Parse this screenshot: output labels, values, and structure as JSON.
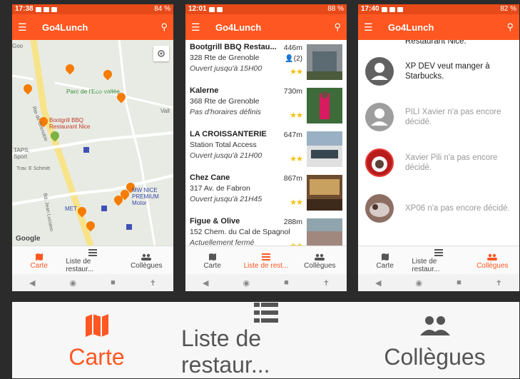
{
  "screens": [
    {
      "status_time": "17:38",
      "battery": "84 %",
      "app_title": "Go4Lunch",
      "map_labels": {
        "park": "Parc de l'Eco-vallée",
        "bbq": "Bootgrill BBQ Restaurant Nice",
        "taps": "TAPS, Sport",
        "mw": "MW NICE PREMIUM Motor",
        "met": "MET",
        "trav": "Trav. E Schmitt",
        "rte": "Rte de Grenoble",
        "jean": "Bd. Jean Luciano",
        "goo": "Goo",
        "vall": "Vall",
        "google": "Google"
      }
    },
    {
      "status_time": "12:01",
      "battery": "88 %",
      "app_title": "Go4Lunch",
      "restaurants": [
        {
          "name": "Bootgrill BBQ Restau...",
          "address": "328 Rte de Grenoble",
          "hours": "Ouvert jusqu'à 15H00",
          "distance": "446m",
          "workmates": "(2)",
          "stars": "★★"
        },
        {
          "name": "Kalerne",
          "address": "368 Rte de Grenoble",
          "hours": "Pas d'horaires définis",
          "distance": "730m",
          "stars": "★★"
        },
        {
          "name": "LA CROISSANTERIE",
          "address": "Station Total Access",
          "hours": "Ouvert jusqu'à 21H00",
          "distance": "647m",
          "stars": "★★"
        },
        {
          "name": "Chez Cane",
          "address": "317 Av. de Fabron",
          "hours": "Ouvert jusqu'à 21H45",
          "distance": "867m",
          "stars": "★★"
        },
        {
          "name": "Figue & Olive",
          "address": "152 Chem. du Cal de Spagnol",
          "hours": "Actuellement fermé",
          "distance": "288m",
          "stars": "★★"
        }
      ]
    },
    {
      "status_time": "17:40",
      "battery": "82 %",
      "app_title": "Go4Lunch",
      "top_partial": "Restaurant Nice.",
      "colleagues": [
        {
          "text": "XP DEV veut manger à Starbucks.",
          "decided": true
        },
        {
          "text": "PILI Xavier n'a pas encore décidé.",
          "decided": false
        },
        {
          "text": "Xavier Pili n'a pas encore décidé.",
          "decided": false
        },
        {
          "text": "XP06 n'a pas encore décidé.",
          "decided": false
        }
      ]
    }
  ],
  "nav": {
    "carte": "Carte",
    "liste_short": "Liste de restaur...",
    "liste_short2": "Liste de rest...",
    "collegues": "Collègues"
  },
  "zoom_nav": {
    "carte": "Carte",
    "liste": "Liste de restaur...",
    "collegues": "Collègues"
  },
  "colors": {
    "accent": "#ff5722",
    "statusbar": "#e64a19",
    "star": "#f4c20d"
  }
}
